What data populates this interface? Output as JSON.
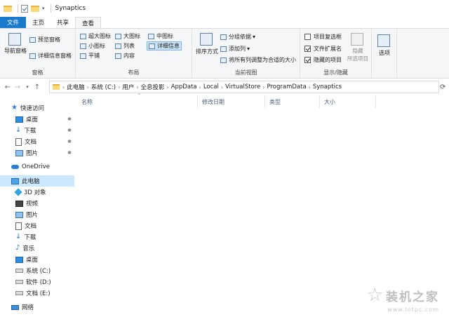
{
  "window": {
    "title": "Synaptics"
  },
  "tabs": [
    {
      "label": "文件"
    },
    {
      "label": "主页"
    },
    {
      "label": "共享"
    },
    {
      "label": "查看"
    }
  ],
  "ribbon": {
    "pane": {
      "nav_pane": "导航窗格",
      "preview": "预览窗格",
      "details": "详细信息窗格",
      "group": "窗格"
    },
    "layout": {
      "xl_icons": "超大图标",
      "large_icons": "大图标",
      "medium_icons": "中图标",
      "small_icons": "小图标",
      "list": "列表",
      "details": "详细信息",
      "tiles": "平铺",
      "content": "内容",
      "group": "布局"
    },
    "current_view": {
      "sort_by": "排序方式",
      "group_by": "分组依据",
      "add_col": "添加列",
      "fit_cols": "将所有列调整为合适的大小",
      "group": "当前视图"
    },
    "show_hide": {
      "item_checkboxes": "项目复选框",
      "file_ext": "文件扩展名",
      "hidden_items": "隐藏的项目",
      "hide_selected": "隐藏",
      "hide_selected_2": "所选项目",
      "group": "显示/隐藏",
      "checkboxes_state": [
        false,
        true,
        true
      ]
    },
    "options": "选项"
  },
  "address": {
    "crumbs": [
      "此电脑",
      "系统 (C:)",
      "用户",
      "全息投影",
      "AppData",
      "Local",
      "VirtualStore",
      "ProgramData",
      "Synaptics"
    ]
  },
  "nav": {
    "quick_access": "快速访问",
    "qa_items": [
      "桌面",
      "下载",
      "文档",
      "图片"
    ],
    "onedrive": "OneDrive",
    "this_pc": "此电脑",
    "pc_items": [
      "3D 对象",
      "视频",
      "图片",
      "文档",
      "下载",
      "音乐",
      "桌面",
      "系统 (C:)",
      "软件 (D:)",
      "文档 (E:)"
    ],
    "network": "网络"
  },
  "columns": [
    "名称",
    "修改日期",
    "类型",
    "大小"
  ],
  "watermark": {
    "text": "装机之家",
    "url": "www.lotpc.com"
  }
}
